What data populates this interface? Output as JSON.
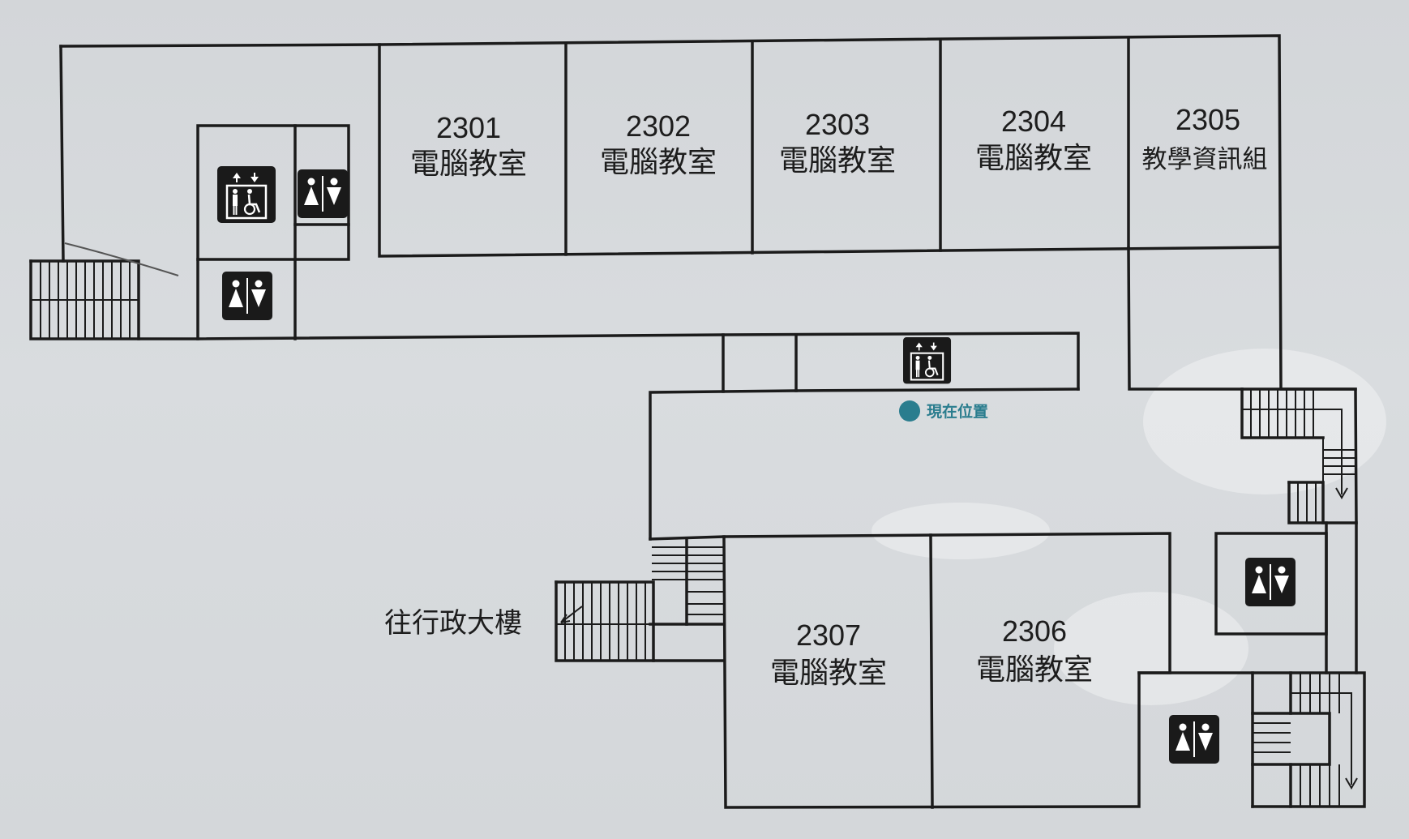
{
  "rooms": {
    "r2301": {
      "number": "2301",
      "name": "電腦教室"
    },
    "r2302": {
      "number": "2302",
      "name": "電腦教室"
    },
    "r2303": {
      "number": "2303",
      "name": "電腦教室"
    },
    "r2304": {
      "number": "2304",
      "name": "電腦教室"
    },
    "r2305": {
      "number": "2305",
      "name": "教學資訊組"
    },
    "r2306": {
      "number": "2306",
      "name": "電腦教室"
    },
    "r2307": {
      "number": "2307",
      "name": "電腦教室"
    }
  },
  "direction_label": "往行政大樓",
  "you_are_here": {
    "label": "現在位置",
    "color": "#2a7d8e"
  },
  "icons": {
    "elevator": "elevator-accessible-icon",
    "restroom": "restroom-icon",
    "stairs": "stairs-icon"
  },
  "colors": {
    "wall": "#1b1b1b",
    "background": "#d6d9dc",
    "icon_bg": "#1a1a1a"
  }
}
